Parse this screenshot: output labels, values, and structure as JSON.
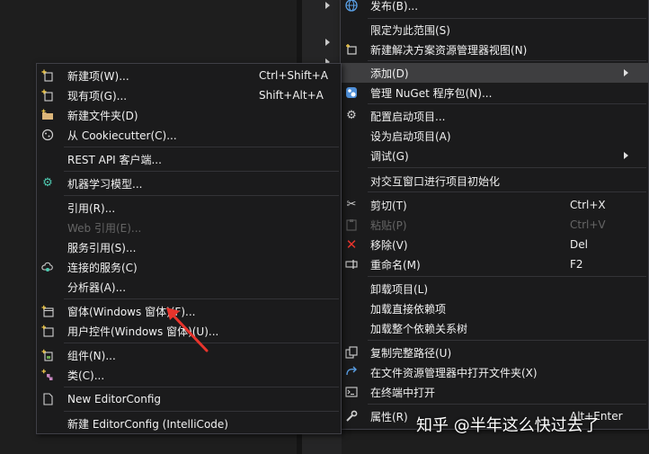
{
  "main_menu": {
    "items": [
      {
        "label": "发布(B)...",
        "icon": "globe-icon"
      },
      {
        "label": "限定为此范围(S)"
      },
      {
        "label": "新建解决方案资源管理器视图(N)",
        "icon": "new-view-icon"
      },
      {
        "label": "添加(D)",
        "submenu": true
      },
      {
        "label": "管理 NuGet 程序包(N)...",
        "icon": "nuget-icon"
      },
      {
        "label": "配置启动项目...",
        "icon": "gear-icon"
      },
      {
        "label": "设为启动项目(A)"
      },
      {
        "label": "调试(G)",
        "submenu": true
      },
      {
        "label": "对交互窗口进行项目初始化"
      },
      {
        "label": "剪切(T)",
        "shortcut": "Ctrl+X",
        "icon": "scissors-icon"
      },
      {
        "label": "粘贴(P)",
        "shortcut": "Ctrl+V",
        "icon": "paste-icon",
        "disabled": true
      },
      {
        "label": "移除(V)",
        "shortcut": "Del",
        "icon": "remove-icon"
      },
      {
        "label": "重命名(M)",
        "shortcut": "F2",
        "icon": "rename-icon"
      },
      {
        "label": "卸载项目(L)"
      },
      {
        "label": "加载直接依赖项"
      },
      {
        "label": "加载整个依赖关系树"
      },
      {
        "label": "复制完整路径(U)",
        "icon": "copy-icon"
      },
      {
        "label": "在文件资源管理器中打开文件夹(X)",
        "icon": "open-folder-icon"
      },
      {
        "label": "在终端中打开",
        "icon": "terminal-icon"
      },
      {
        "label": "属性(R)",
        "shortcut": "Alt+Enter",
        "icon": "wrench-icon"
      }
    ]
  },
  "sub_menu": {
    "items": [
      {
        "label": "新建项(W)...",
        "shortcut": "Ctrl+Shift+A",
        "icon": "new-item-icon"
      },
      {
        "label": "现有项(G)...",
        "shortcut": "Shift+Alt+A",
        "icon": "existing-item-icon"
      },
      {
        "label": "新建文件夹(D)",
        "icon": "new-folder-icon"
      },
      {
        "label": "从 Cookiecutter(C)...",
        "icon": "cookiecutter-icon"
      },
      {
        "label": "REST API 客户端..."
      },
      {
        "label": "机器学习模型...",
        "icon": "ml-model-icon"
      },
      {
        "label": "引用(R)..."
      },
      {
        "label": "Web 引用(E)...",
        "disabled": true
      },
      {
        "label": "服务引用(S)..."
      },
      {
        "label": "连接的服务(C)",
        "icon": "connected-service-icon"
      },
      {
        "label": "分析器(A)..."
      },
      {
        "label": "窗体(Windows 窗体)(F)...",
        "icon": "form-icon"
      },
      {
        "label": "用户控件(Windows 窗体)(U)...",
        "icon": "user-control-icon"
      },
      {
        "label": "组件(N)...",
        "icon": "component-icon"
      },
      {
        "label": "类(C)...",
        "icon": "class-icon"
      },
      {
        "label": "New EditorConfig",
        "icon": "file-icon"
      },
      {
        "label": "新建 EditorConfig (IntelliCode)"
      }
    ]
  },
  "watermark": "知乎 @半年这么快过去了",
  "colors": {
    "menu_bg": "#1b1b1c",
    "menu_border": "#3f3f46",
    "highlight": "#3e3e40",
    "disabled_text": "#656565",
    "annotation_arrow": "#e8342c"
  }
}
